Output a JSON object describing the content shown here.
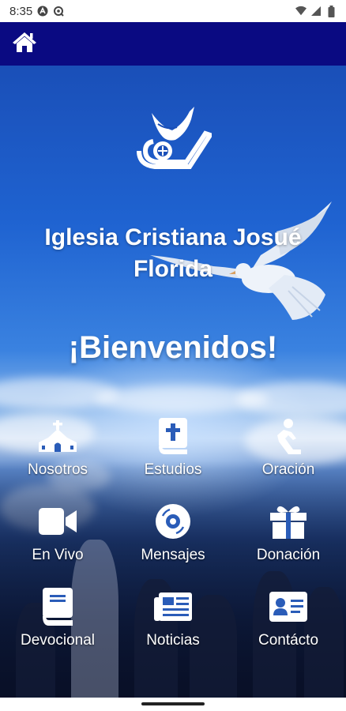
{
  "status_bar": {
    "time": "8:35",
    "icons": [
      "a-circle-icon",
      "spiral-icon",
      "wifi-icon",
      "signal-icon",
      "battery-icon"
    ]
  },
  "app_bar": {
    "background": "#0a0a82",
    "home_icon": "home-icon"
  },
  "hero": {
    "logo_icon": "church-dove-logo",
    "title_line1": "Iglesia Cristiana Josué",
    "title_line2": "Florida",
    "welcome": "¡Bienvenidos!"
  },
  "menu": {
    "items": [
      {
        "label": "Nosotros",
        "icon": "church-icon"
      },
      {
        "label": "Estudios",
        "icon": "bible-icon"
      },
      {
        "label": "Oración",
        "icon": "praying-icon"
      },
      {
        "label": "En Vivo",
        "icon": "video-camera-icon"
      },
      {
        "label": "Mensajes",
        "icon": "disc-icon"
      },
      {
        "label": "Donación",
        "icon": "gift-icon"
      },
      {
        "label": "Devocional",
        "icon": "book-icon"
      },
      {
        "label": "Noticias",
        "icon": "newspaper-icon"
      },
      {
        "label": "Contácto",
        "icon": "contact-card-icon"
      }
    ]
  },
  "colors": {
    "app_bar": "#0a0a82",
    "text": "#ffffff",
    "sky_top": "#1a4fb8"
  }
}
